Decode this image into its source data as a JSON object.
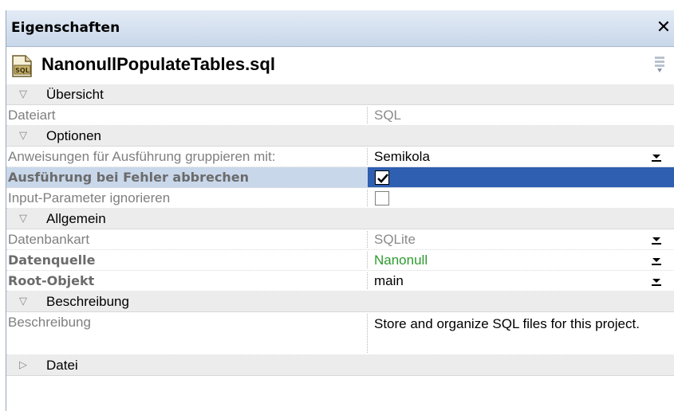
{
  "panel": {
    "title": "Eigenschaften",
    "close_icon": "close-icon",
    "file_name": "NanonullPopulateTables.sql",
    "file_icon": "sql-file-icon",
    "sort_icon": "sort-categories-icon"
  },
  "sections": {
    "ubersicht": {
      "label": "Übersicht",
      "expanded": true
    },
    "optionen": {
      "label": "Optionen",
      "expanded": true
    },
    "allgemein": {
      "label": "Allgemein",
      "expanded": true
    },
    "beschreibung": {
      "label": "Beschreibung",
      "expanded": true
    },
    "datei": {
      "label": "Datei",
      "expanded": false
    }
  },
  "props": {
    "dateiart": {
      "label": "Dateiart",
      "value": "SQL"
    },
    "gruppieren": {
      "label": "Anweisungen für Ausführung gruppieren mit:",
      "value": "Semikola"
    },
    "abbrechen": {
      "label": "Ausführung bei Fehler abbrechen",
      "checked": true
    },
    "ignorieren": {
      "label": "Input-Parameter ignorieren",
      "checked": false
    },
    "datenbankart": {
      "label": "Datenbankart",
      "value": "SQLite"
    },
    "datenquelle": {
      "label": "Datenquelle",
      "value": "Nanonull"
    },
    "rootobjekt": {
      "label": "Root-Objekt",
      "value": "main"
    },
    "beschreibung": {
      "label": "Beschreibung",
      "value": "Store and organize SQL files for this project."
    }
  },
  "colors": {
    "title_bar": "#c9d7ea",
    "section_bg": "#ececec",
    "selection": "#2e5fb0",
    "datasource_green": "#2e9a2e"
  }
}
